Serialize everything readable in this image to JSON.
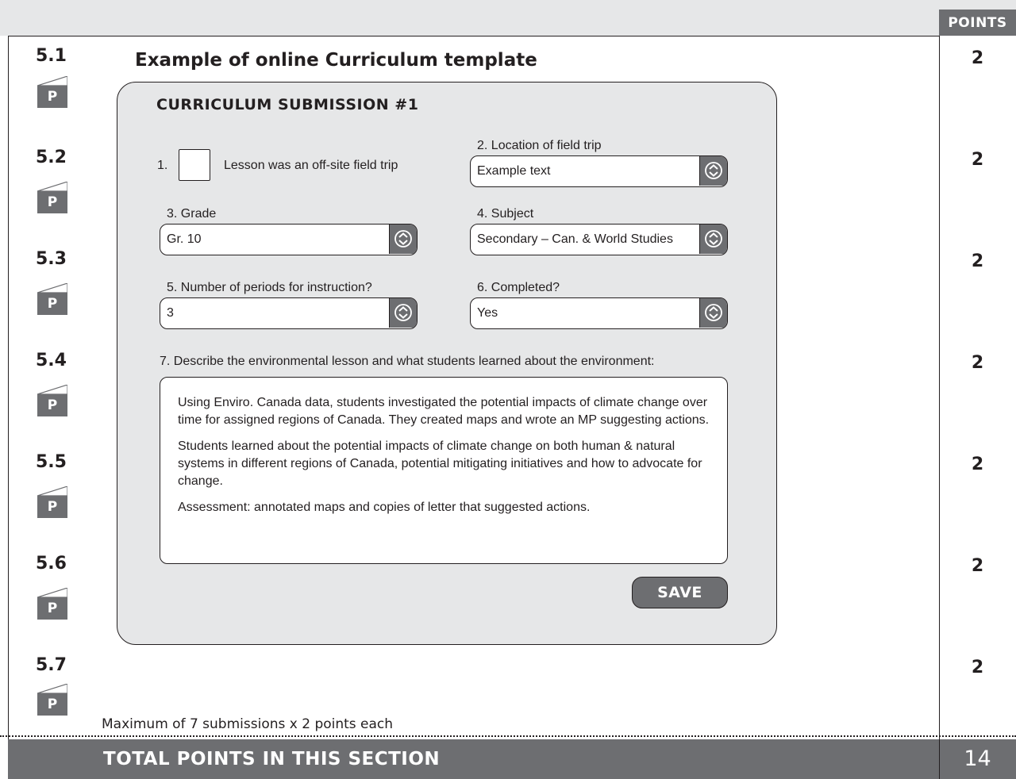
{
  "header": {
    "points_label": "POINTS"
  },
  "items": [
    {
      "number": "5.1",
      "badge": "P",
      "points": "2"
    },
    {
      "number": "5.2",
      "badge": "P",
      "points": "2"
    },
    {
      "number": "5.3",
      "badge": "P",
      "points": "2"
    },
    {
      "number": "5.4",
      "badge": "P",
      "points": "2"
    },
    {
      "number": "5.5",
      "badge": "P",
      "points": "2"
    },
    {
      "number": "5.6",
      "badge": "P",
      "points": "2"
    },
    {
      "number": "5.7",
      "badge": "P",
      "points": "2"
    }
  ],
  "example_title": "Example of online Curriculum template",
  "form": {
    "title": "CURRICULUM SUBMISSION #1",
    "q1": {
      "number": "1.",
      "label": "Lesson was an off-site field trip",
      "checked": false
    },
    "q2": {
      "label": "2. Location of field trip",
      "value": "Example text"
    },
    "q3": {
      "label": "3. Grade",
      "value": "Gr. 10"
    },
    "q4": {
      "label": "4. Subject",
      "value": "Secondary – Can. & World Studies"
    },
    "q5": {
      "label": "5. Number of periods for instruction?",
      "value": "3"
    },
    "q6": {
      "label": "6. Completed?",
      "value": "Yes"
    },
    "q7": {
      "label": "7. Describe the environmental lesson and what students learned about the environment:",
      "paragraphs": [
        "Using Enviro. Canada data, students investigated the potential impacts of climate change over time for assigned regions of Canada. They created maps and wrote an MP suggesting actions.",
        "Students learned about the potential impacts of climate change on both human & natural systems in different regions of Canada, potential mitigating initiatives and how to advocate for change.",
        "Assessment: annotated maps and copies of letter that suggested actions."
      ]
    },
    "save_label": "SAVE"
  },
  "max_note": "Maximum of 7 submissions x 2 points each",
  "footer": {
    "label": "TOTAL POINTS IN THIS SECTION",
    "total": "14"
  }
}
